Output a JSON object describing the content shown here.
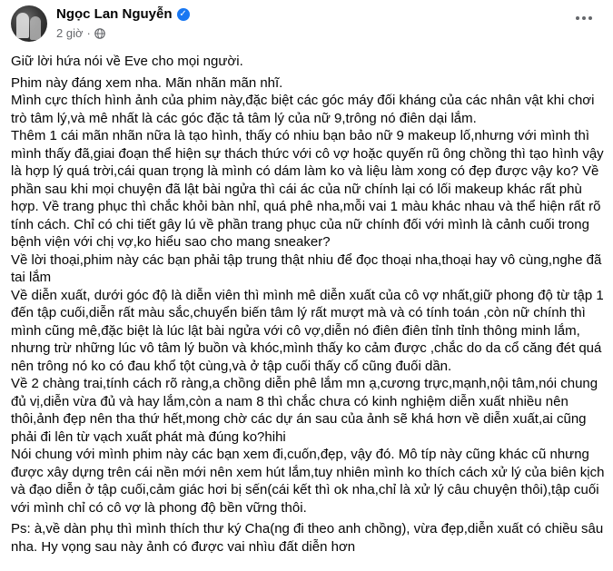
{
  "post": {
    "author": "Ngọc Lan Nguyễn",
    "time": "2 giờ",
    "dot": "·",
    "paragraphs": [
      "Giữ lời hứa nói về Eve cho mọi người.",
      "Phim này đáng xem nha. Mãn nhãn mãn nhĩ.",
      "Mình cực thích hình ảnh của phim này,đặc biệt các góc máy đối kháng của các nhân vật khi chơi trò tâm lý,và mê nhất là các góc đặc tả tâm lý của nữ 9,trông nó điên dại lắm.",
      "Thêm 1 cái mãn nhãn nữa là tạo hình, thấy có nhiu bạn bảo nữ 9 makeup lố,nhưng với mình thì mình thấy đã,giai đoạn thể hiện sự thách thức với cô vợ hoặc quyến rũ ông chồng thì tạo hình vậy là hợp lý quá trời,cái quan trọng là mình có dám làm ko và liệu làm xong có đẹp được vậy ko? Về phần sau khi mọi chuyện đã lật bài ngửa thì cái ác của nữ chính lại có lối makeup khác rất phù hợp. Về trang phục thì chắc khỏi bàn nhỉ, quá phê nha,mỗi vai 1 màu khác nhau và thể hiện rất rõ tính cách. Chỉ có chi tiết gây lú về phần trang phục của nữ chính đối với mình là cảnh cuối trong bệnh viện với chị vợ,ko hiểu sao cho mang sneaker?",
      "Về lời thoại,phim này các bạn phải tập trung thật nhiu để đọc thoại nha,thoại hay vô cùng,nghe đã tai lắm",
      "Về diễn xuất, dưới góc độ là diễn viên thì mình mê diễn xuất của cô vợ nhất,giữ phong độ từ tập 1 đến tập cuối,diễn rất màu sắc,chuyển biến tâm lý rất mượt mà và có tính toán ,còn nữ chính thì mình cũng mê,đặc biệt là lúc lật bài ngửa với cô vợ,diễn nó điên điên tỉnh tỉnh thông minh lắm, nhưng trừ những lúc vô tâm lý buồn và khóc,mình thấy ko cảm được ,chắc do da cổ căng đét quá nên trông nó ko có đau khổ tột cùng,và ở tập cuối thấy cổ cũng đuối dần.",
      "Về 2 chàng trai,tính cách rõ ràng,a chồng diễn phê lắm mn ạ,cương trực,mạnh,nội tâm,nói chung đủ vị,diễn vừa đủ và hay lắm,còn a nam 8 thì chắc chưa có kinh nghiệm diễn xuất nhiều nên thôi,ảnh đẹp nên tha thứ hết,mong chờ các dự án sau của ảnh sẽ khá hơn về diễn xuất,ai cũng phải đi lên từ vạch xuất phát mà đúng ko?hihi",
      "Nói chung với mình phim này các bạn xem đi,cuốn,đẹp, vậy đó. Mô típ này cũng khác cũ nhưng được xây dựng trên cái nền mới nên xem hút lắm,tuy nhiên mình ko thích cách xử lý của biên kịch và đạo diễn ở tập cuối,cảm giác hơi bị sến(cái kết thì ok nha,chỉ là xử lý câu chuyện thôi),tập cuối với mình chỉ có cô vợ là phong độ bền vững thôi.",
      "Ps: à,về dàn phụ thì mình thích thư ký Cha(ng đi theo anh chồng), vừa đẹp,diễn xuất có chiều sâu nha. Hy vọng sau này ảnh có được vai nhìu đất diễn hơn"
    ]
  },
  "icons": {
    "verified": "verified-badge-icon",
    "audience": "globe-icon",
    "more": "more-options-icon"
  },
  "colors": {
    "verified_blue": "#1877f2",
    "meta_gray": "#65676b",
    "text": "#050505"
  }
}
